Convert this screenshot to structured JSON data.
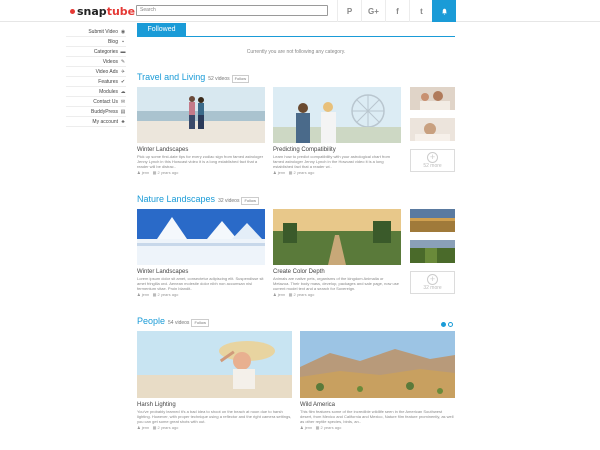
{
  "header": {
    "logo_snap": "snap",
    "logo_tube": "tube",
    "search_placeholder": "Search",
    "social": [
      "P",
      "G+",
      "f",
      "t"
    ]
  },
  "sidebar": {
    "items": [
      {
        "label": "Submit Video",
        "icon": "eye-icon",
        "glyph": "◉"
      },
      {
        "label": "Blog",
        "icon": "comment-icon",
        "glyph": "▪"
      },
      {
        "label": "Categories",
        "icon": "folder-icon",
        "glyph": "▬"
      },
      {
        "label": "Videos",
        "icon": "film-icon",
        "glyph": "✎"
      },
      {
        "label": "Video Ads",
        "icon": "megaphone-icon",
        "glyph": "✈"
      },
      {
        "label": "Features",
        "icon": "pin-icon",
        "glyph": "✔"
      },
      {
        "label": "Modules",
        "icon": "cloud-icon",
        "glyph": "☁"
      },
      {
        "label": "Contact Us",
        "icon": "mail-icon",
        "glyph": "✉"
      },
      {
        "label": "BuddyPress",
        "icon": "chat-icon",
        "glyph": "▤"
      },
      {
        "label": "My account",
        "icon": "users-icon",
        "glyph": "♣"
      }
    ]
  },
  "main": {
    "tab": "Followed",
    "notice": "Currently you are not following any category."
  },
  "sections": [
    {
      "name": "Travel and Living",
      "count": "52 videos",
      "follow": "Follow",
      "more": "52 more",
      "cards": [
        {
          "title": "Winter Landscapes",
          "desc": "Pick up some first-date tips for every zodiac sign from famed astrologer Jenny Lynch in this Howcast video it is a long established fact that a reader will be distrac..",
          "author": "jenn",
          "date": "2 years ago"
        },
        {
          "title": "Predicting Compatibility",
          "desc": "Learn how to predict compatibility with your astrological chart from famed astrologer Jenny Lynch in the Howcast video it is a long established fact that a reader wi..",
          "author": "jenn",
          "date": "2 years ago"
        }
      ]
    },
    {
      "name": "Nature Landscapes",
      "count": "32 videos",
      "follow": "Follow",
      "more": "32 more",
      "cards": [
        {
          "title": "Winter Landscapes",
          "desc": "Lorem ipsum dolor sit amet, consectetur adipiscing elit. Suspendisse sit amet fringilla orci. Aenean molestie dolor nibh non accumsan nisl fermentum vitae. Proin blandit..",
          "author": "jenn",
          "date": "2 years ago"
        },
        {
          "title": "Create Color Depth",
          "desc": "Animals are native pets, organisms of the kingdom Animalia or Metazoa. Their body mass, develop, packages and sale page, now use current model text and a search for Sovereign.",
          "author": "jenn",
          "date": "2 years ago"
        }
      ]
    },
    {
      "name": "People",
      "count": "54 videos",
      "follow": "Follow",
      "cards": [
        {
          "title": "Harsh Lighting",
          "desc": "You've probably learned it's a bad idea to shoot on the beach at noon due to harsh lighting. However, with proper technique using a reflector and the right camera settings, you can get some great shots with out.",
          "author": "jenn",
          "date": "2 years ago"
        },
        {
          "title": "Wild America",
          "desc": "This film features some of the incredible wildlife seen in the American Southwest desert, from Mexico and California and Mexico, Nature film feature prominently, as well as other reptile species, birds, an..",
          "author": "jenn",
          "date": "2 years ago"
        }
      ]
    }
  ],
  "colors": {
    "accent": "#1a9bd7",
    "brand_red": "#e53935"
  }
}
